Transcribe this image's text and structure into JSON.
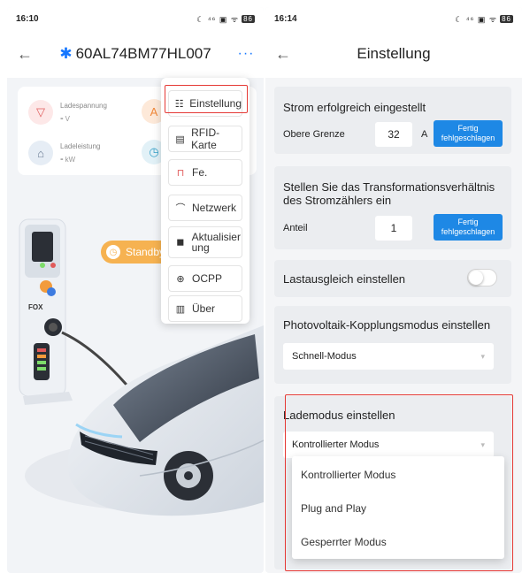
{
  "left": {
    "status": {
      "time": "16:10",
      "icons": "☾ ⁴⁶ ▣ ᯤ",
      "battery": "86"
    },
    "nav": {
      "back": "←",
      "title": "60AL74BM77HL007",
      "more": "···"
    },
    "metrics": [
      {
        "label": "Ladespannung",
        "value": "-",
        "unit": "V",
        "icon": "voltage-icon"
      },
      {
        "label": "Ladeleistung",
        "value": "-",
        "unit": "kW",
        "icon": "power-icon"
      }
    ],
    "standby": "Standby",
    "brand_logo": "FOX",
    "menu": [
      {
        "label": "Einstellung",
        "icon": "settings-icon"
      },
      {
        "label": "RFID-Karte",
        "icon": "card-icon"
      },
      {
        "label": "Fe.",
        "icon": "trash-icon"
      },
      {
        "label": "Netzwerk",
        "icon": "network-icon"
      },
      {
        "label": "Aktualisierung",
        "icon": "update-icon"
      },
      {
        "label": "OCPP",
        "icon": "globe-icon"
      },
      {
        "label": "Über",
        "icon": "info-icon"
      }
    ]
  },
  "right": {
    "status": {
      "time": "16:14",
      "icons": "☾ ⁴⁶ ▣ ᯤ",
      "battery": "86"
    },
    "nav": {
      "back": "←",
      "title": "Einstellung"
    },
    "current": {
      "title": "Strom erfolgreich eingestellt",
      "label": "Obere Grenze",
      "value": "32",
      "unit": "A",
      "button": "Fertig fehlgeschlagen"
    },
    "ratio": {
      "title": "Stellen Sie das Transformationsverhältnis des Stromzählers ein",
      "label": "Anteil",
      "value": "1",
      "button": "Fertig fehlgeschlagen"
    },
    "load_balance": {
      "label": "Lastausgleich einstellen",
      "enabled": false
    },
    "pv": {
      "title": "Photovoltaik-Kopplungsmodus einstellen",
      "selected": "Schnell-Modus"
    },
    "charge_mode": {
      "title": "Lademodus einstellen",
      "selected": "Kontrollierter Modus",
      "options": [
        "Kontrollierter Modus",
        "Plug and Play",
        "Gesperrter Modus"
      ]
    }
  },
  "colors": {
    "accent": "#1e88e5",
    "highlight": "#e53935",
    "standby": "#f6b251"
  }
}
